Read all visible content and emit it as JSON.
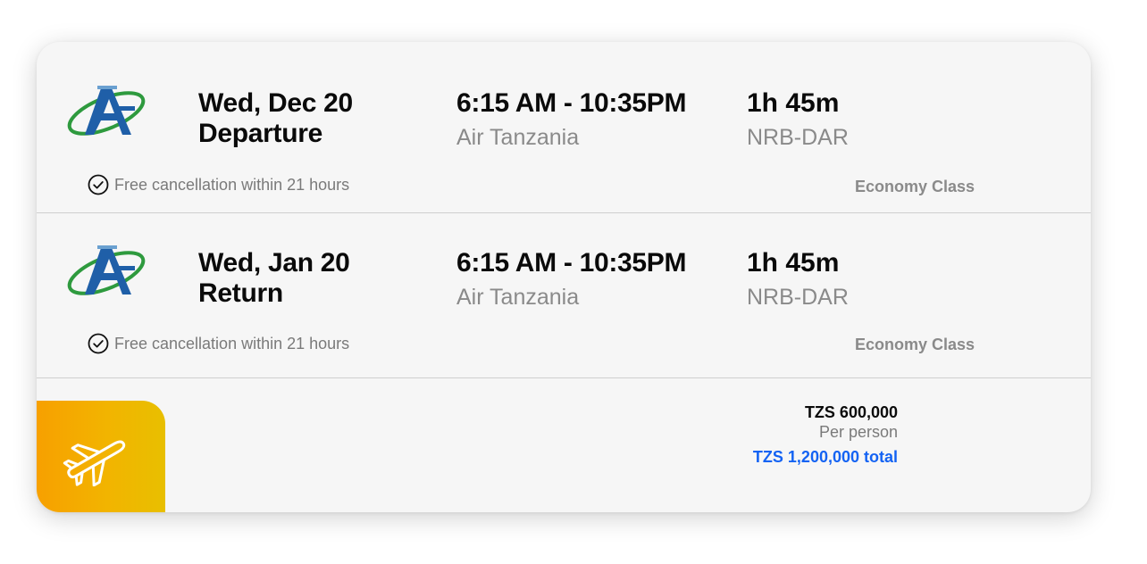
{
  "legs": [
    {
      "date": "Wed, Dec 20",
      "direction": "Departure",
      "time": "6:15 AM - 10:35PM",
      "airline": "Air Tanzania",
      "duration": "1h 45m",
      "route": "NRB-DAR",
      "cancellation": "Free cancellation within 21 hours",
      "class": "Economy Class",
      "logo_icon": "air-tanzania-logo"
    },
    {
      "date": "Wed, Jan 20",
      "direction": "Return",
      "time": "6:15 AM - 10:35PM",
      "airline": "Air Tanzania",
      "duration": "1h 45m",
      "route": "NRB-DAR",
      "cancellation": "Free cancellation within 21 hours",
      "class": "Economy Class",
      "logo_icon": "air-tanzania-logo"
    }
  ],
  "pricing": {
    "price": "TZS 600,000",
    "per_person": "Per person",
    "total": "TZS 1,200,000 total"
  },
  "badge_icon": "airplane-icon",
  "colors": {
    "accent_blue": "#1463f3",
    "badge_gradient_start": "#f7a000",
    "badge_gradient_end": "#e8bf00",
    "logo_blue": "#1f5fa8",
    "logo_green": "#2e9a3e"
  }
}
